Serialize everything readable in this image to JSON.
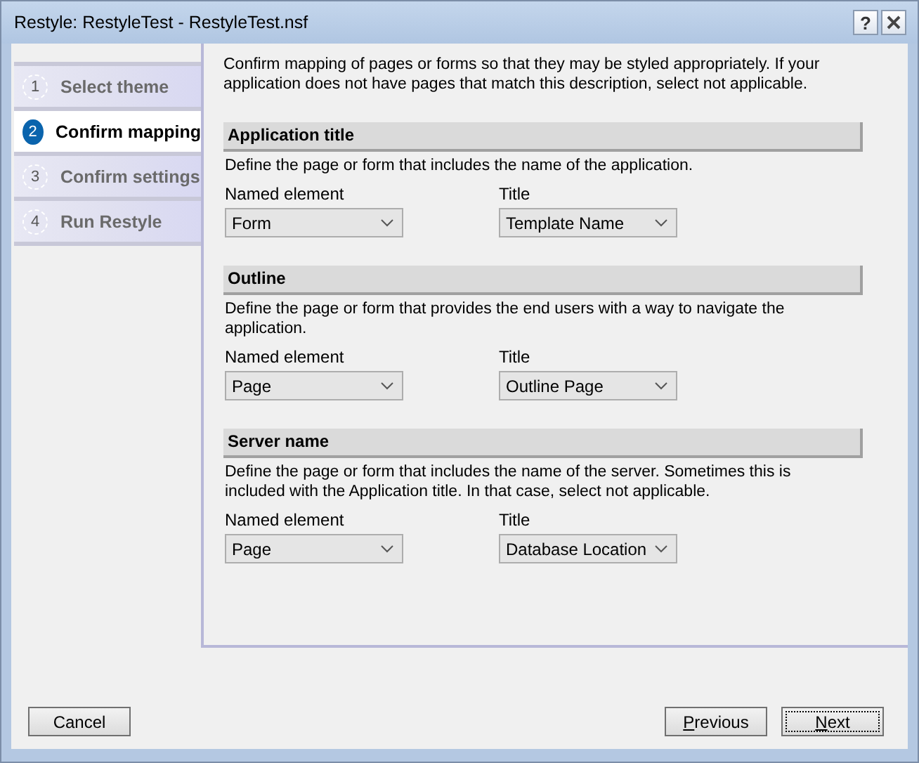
{
  "window": {
    "title": "Restyle: RestyleTest - RestyleTest.nsf",
    "help_label": "?"
  },
  "steps": [
    {
      "number": "1",
      "label": "Select theme",
      "selected": false
    },
    {
      "number": "2",
      "label": "Confirm mapping",
      "selected": true
    },
    {
      "number": "3",
      "label": "Confirm settings",
      "selected": false
    },
    {
      "number": "4",
      "label": "Run Restyle",
      "selected": false
    }
  ],
  "intro": "Confirm mapping of pages or forms so that they may be styled appropriately. If your application does not have pages that match this description, select not applicable.",
  "sections": [
    {
      "heading": "Application title",
      "description": "Define the page or form that includes the name of the application.",
      "fields": [
        {
          "label": "Named element",
          "value": "Form"
        },
        {
          "label": "Title",
          "value": "Template Name"
        }
      ]
    },
    {
      "heading": "Outline",
      "description": "Define the page or form that provides the end users with a way to navigate the application.",
      "fields": [
        {
          "label": "Named element",
          "value": "Page"
        },
        {
          "label": "Title",
          "value": "Outline Page"
        }
      ]
    },
    {
      "heading": "Server name",
      "description": "Define the page or form that includes the name of the server. Sometimes this is included with the Application title.  In that case, select not applicable.",
      "fields": [
        {
          "label": "Named element",
          "value": "Page"
        },
        {
          "label": "Title",
          "value": "Database Location"
        }
      ]
    }
  ],
  "buttons": [
    {
      "label": "Cancel",
      "access_key_underlined": false,
      "focused": false
    },
    {
      "label": "Previous",
      "access_key_underlined": true,
      "focused": false
    },
    {
      "label": "Next",
      "access_key_underlined": true,
      "focused": true
    }
  ]
}
